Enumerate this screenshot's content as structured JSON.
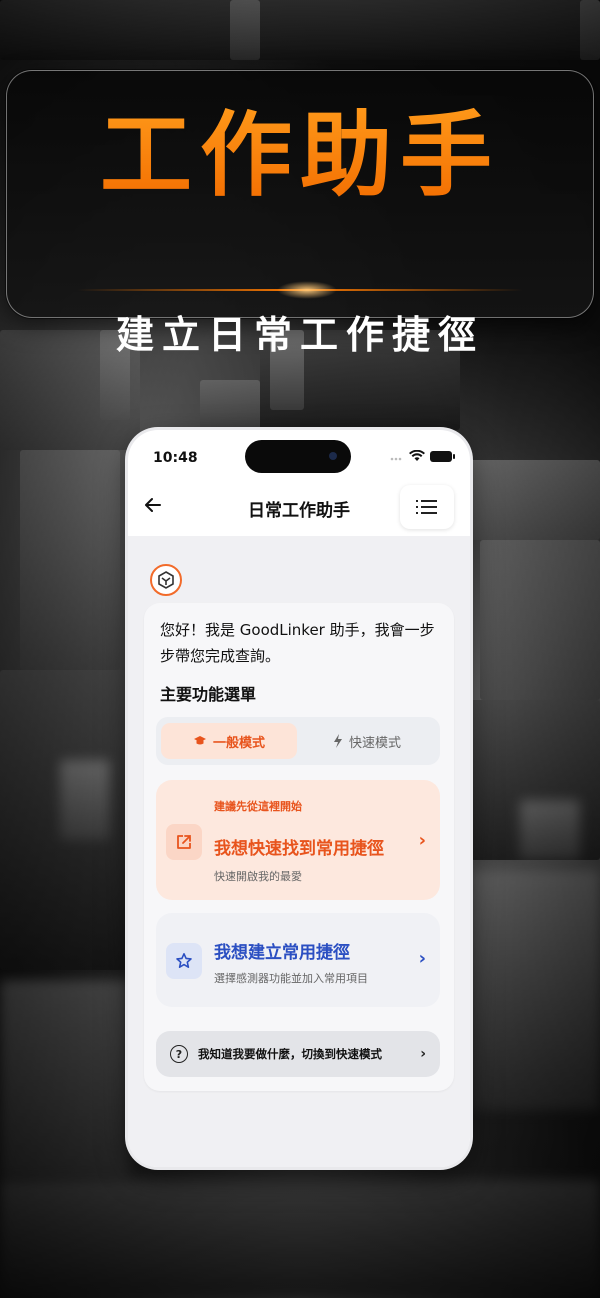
{
  "banner": {
    "title": "工作助手",
    "subtitle": "建立日常工作捷徑"
  },
  "status_bar": {
    "time": "10:48"
  },
  "nav": {
    "back_icon": "arrow-left-icon",
    "title": "日常工作助手",
    "menu_icon": "list-icon"
  },
  "chat": {
    "avatar_icon": "goodlinker-logo-icon",
    "greeting": "您好！我是 GoodLinker 助手，我會一步步帶您完成查詢。",
    "menu_heading": "主要功能選單",
    "modes": [
      {
        "label": "一般模式",
        "icon": "graduation-cap-icon",
        "active": true
      },
      {
        "label": "快速模式",
        "icon": "lightning-icon",
        "active": false
      }
    ],
    "options": [
      {
        "hint": "建議先從這裡開始",
        "title": "我想快速找到常用捷徑",
        "description": "快速開啟我的最愛",
        "icon": "external-link-icon"
      },
      {
        "title": "我想建立常用捷徑",
        "description": "選擇感測器功能並加入常用項目",
        "icon": "star-icon"
      }
    ],
    "switch_prompt": "我知道我要做什麼，切換到快速模式"
  },
  "colors": {
    "accent_orange": "#e8541d",
    "accent_blue": "#2b4fc2",
    "banner_orange": "#ff7a00"
  }
}
